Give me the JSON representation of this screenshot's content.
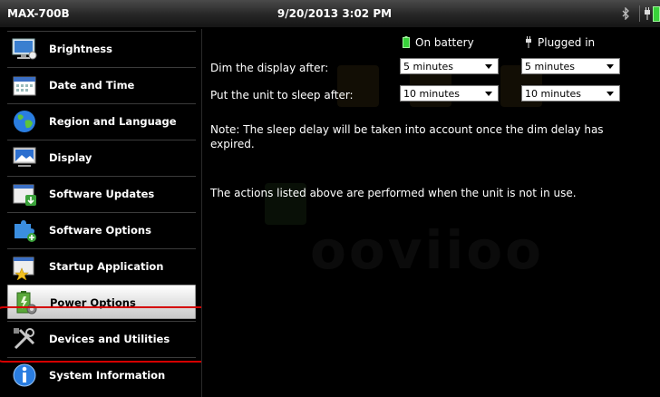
{
  "status": {
    "model": "MAX-700B",
    "datetime": "9/20/2013 3:02 PM"
  },
  "sidebar": {
    "items": [
      {
        "label": "Brightness",
        "icon": "monitor-brightness-icon"
      },
      {
        "label": "Date and Time",
        "icon": "calendar-icon"
      },
      {
        "label": "Region and Language",
        "icon": "globe-icon"
      },
      {
        "label": "Display",
        "icon": "display-icon"
      },
      {
        "label": "Software Updates",
        "icon": "download-update-icon"
      },
      {
        "label": "Software Options",
        "icon": "puzzle-icon"
      },
      {
        "label": "Startup Application",
        "icon": "star-folder-icon"
      },
      {
        "label": "Power Options",
        "icon": "battery-gear-icon"
      },
      {
        "label": "Devices and Utilities",
        "icon": "tools-icon"
      },
      {
        "label": "System Information",
        "icon": "info-icon"
      }
    ],
    "active_index": 7
  },
  "power": {
    "col_battery": "On battery",
    "col_plugged": "Plugged in",
    "dim_label": "Dim the display after:",
    "sleep_label": "Put the unit to sleep after:",
    "dim_battery": "5 minutes",
    "dim_plugged": "5 minutes",
    "sleep_battery": "10 minutes",
    "sleep_plugged": "10 minutes",
    "note": "Note: The sleep delay will be taken into account once the dim delay has expired.",
    "actions": "The actions listed above are performed when the unit is not in use."
  },
  "colors": {
    "battery_green": "#38d13a",
    "highlight_red": "#d40000",
    "active_item_bg": "#e6e6e6"
  }
}
